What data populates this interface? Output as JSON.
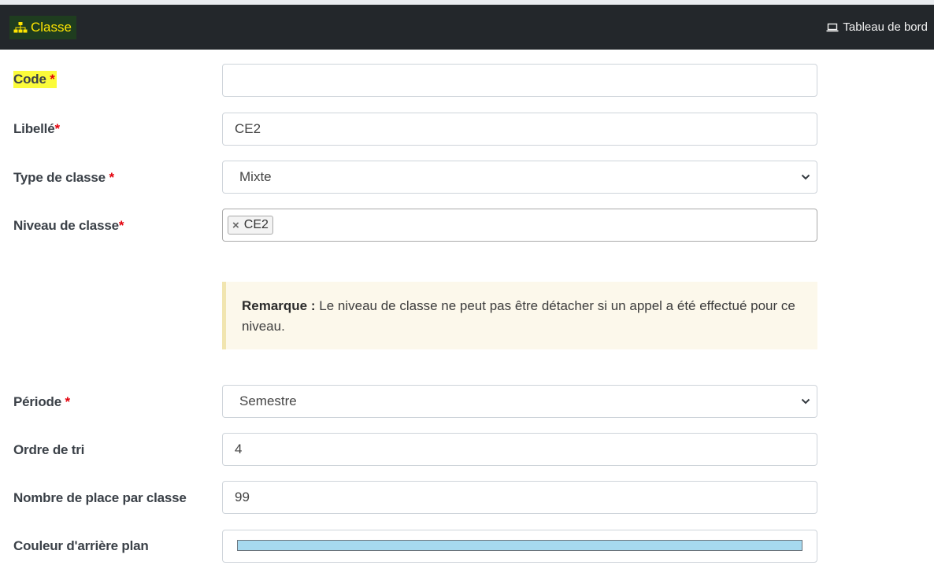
{
  "header": {
    "title": "Classe",
    "title_icon": "sitemap-icon",
    "dashboard_label": "Tableau de bord",
    "dashboard_icon": "laptop-icon"
  },
  "form": {
    "code": {
      "label": "Code",
      "required_mark": "*",
      "value": ""
    },
    "libelle": {
      "label": "Libellé",
      "required_mark": "*",
      "value": "CE2"
    },
    "type_classe": {
      "label": "Type de classe",
      "required_mark": "*",
      "selected": "Mixte"
    },
    "niveau_classe": {
      "label": "Niveau de classe",
      "required_mark": "*",
      "tag": "CE2",
      "tag_remove": "×"
    },
    "remark": {
      "title": "Remarque :",
      "text": "Le niveau de classe ne peut pas être détacher si un appel a été effectué pour ce niveau."
    },
    "periode": {
      "label": "Période",
      "required_mark": "*",
      "selected": "Semestre"
    },
    "ordre_tri": {
      "label": "Ordre de tri",
      "value": "4"
    },
    "nombre_place": {
      "label": "Nombre de place par classe",
      "value": "99"
    },
    "couleur": {
      "label": "Couleur d'arrière plan",
      "value_color": "#a6d9ef"
    }
  },
  "colors": {
    "header_bg": "#23272b",
    "brand_text": "#ffe500",
    "required": "#e3000b",
    "highlight": "#fbfb3a",
    "remark_bg": "#fcf8eb"
  }
}
